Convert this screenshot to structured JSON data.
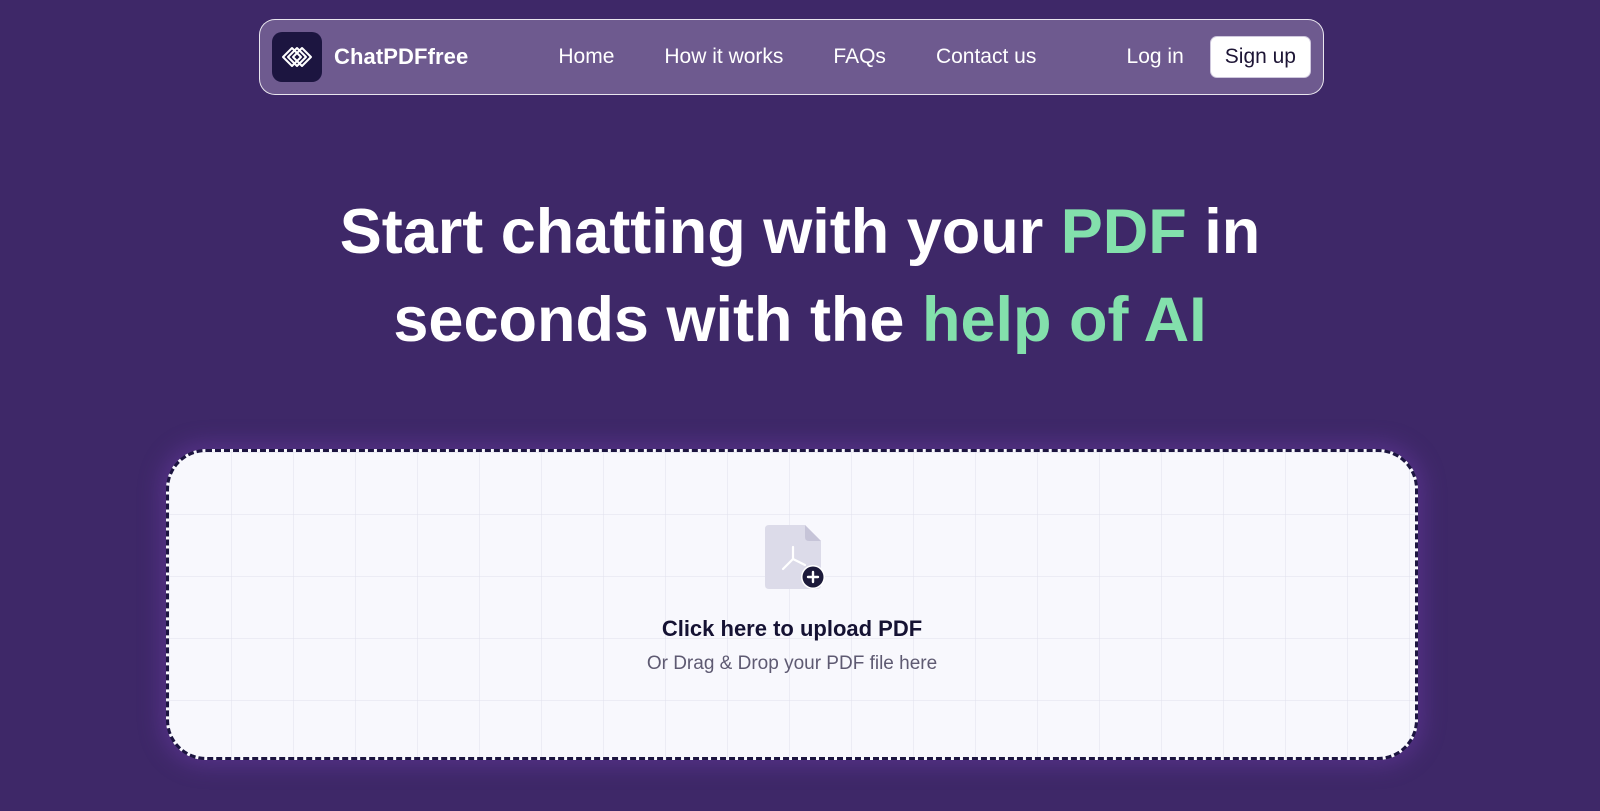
{
  "nav": {
    "brand_name": "ChatPDFfree",
    "links": [
      "Home",
      "How it works",
      "FAQs",
      "Contact us"
    ],
    "login_label": "Log in",
    "signup_label": "Sign up"
  },
  "hero": {
    "line1_prefix": "Start chatting with your ",
    "line1_accent": "PDF",
    "line1_suffix": " in",
    "line2_prefix": "seconds with the ",
    "line2_accent": "help of AI"
  },
  "upload": {
    "icon": "pdf-file-add-icon",
    "title": "Click here to upload PDF",
    "subtitle": "Or Drag & Drop your PDF file here"
  },
  "colors": {
    "background": "#3e2868",
    "navbar": "#6e5a8f",
    "accent": "#83e0ac",
    "logo_bg": "#1c1540",
    "upload_bg": "#f8f8fd"
  }
}
